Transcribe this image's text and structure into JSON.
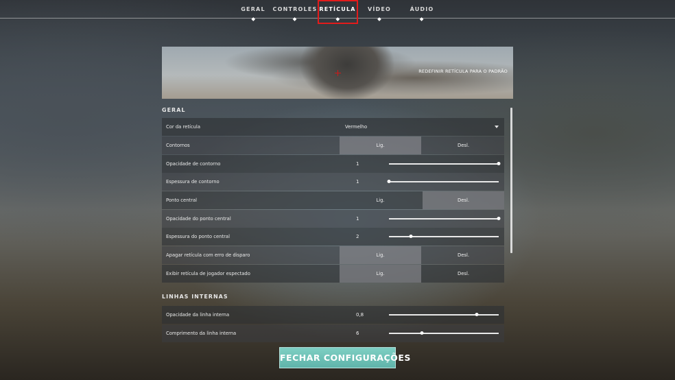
{
  "nav": {
    "tabs": [
      "GERAL",
      "CONTROLES",
      "RETÍCULA",
      "VÍDEO",
      "ÁUDIO"
    ],
    "active": "RETÍCULA"
  },
  "preview": {
    "reset_label": "REDEFINIR RETÍCULA PARA O PADRÃO",
    "crosshair_color": "#d11818"
  },
  "sections": {
    "geral": {
      "title": "GERAL",
      "rows": {
        "cor": {
          "label": "Cor da retícula",
          "value": "Vermelho"
        },
        "contornos": {
          "label": "Contornos",
          "on": "Lig.",
          "off": "Desl.",
          "selected": "on"
        },
        "opac_contorno": {
          "label": "Opacidade de contorno",
          "value": "1",
          "fraction": 1.0
        },
        "esp_contorno": {
          "label": "Espessura de contorno",
          "value": "1",
          "fraction": 0.0
        },
        "ponto_central": {
          "label": "Ponto central",
          "on": "Lig.",
          "off": "Desl.",
          "selected": "off"
        },
        "opac_ponto": {
          "label": "Opacidade do ponto central",
          "value": "1",
          "fraction": 1.0
        },
        "esp_ponto": {
          "label": "Espessura do ponto central",
          "value": "2",
          "fraction": 0.2
        },
        "apagar": {
          "label": "Apagar retícula com erro de disparo",
          "on": "Lig.",
          "off": "Desl.",
          "selected": "on"
        },
        "exibir": {
          "label": "Exibir retícula de jogador espectado",
          "on": "Lig.",
          "off": "Desl.",
          "selected": "on"
        }
      }
    },
    "linhas": {
      "title": "LINHAS INTERNAS",
      "rows": {
        "opac_linha": {
          "label": "Opacidade da linha interna",
          "value": "0,8",
          "fraction": 0.8
        },
        "comp_linha": {
          "label": "Comprimento da linha interna",
          "value": "6",
          "fraction": 0.3
        }
      }
    }
  },
  "footer": {
    "close_label": "FECHAR CONFIGURAÇÕES"
  },
  "colors": {
    "accent": "#6fc3b8",
    "highlight_box": "#e31b1b"
  }
}
